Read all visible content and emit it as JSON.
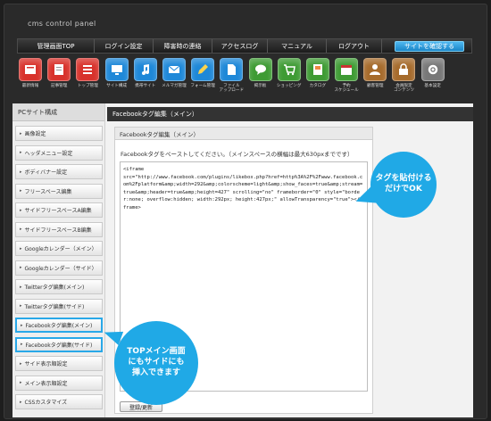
{
  "brand": "cms control panel",
  "nav": {
    "items": [
      "管理画面TOP",
      "ログイン設定",
      "障害時の連絡",
      "アクセスログ",
      "マニュアル",
      "ログアウト"
    ],
    "cta": "サイトを確認する"
  },
  "toolbar": {
    "tools": [
      {
        "label": "最新情報",
        "icon": "news-icon",
        "color": "#d8322b"
      },
      {
        "label": "記事管理",
        "icon": "article-icon",
        "color": "#d8322b"
      },
      {
        "label": "トップ管理",
        "icon": "list-icon",
        "color": "#d8322b"
      },
      {
        "label": "サイト構成",
        "icon": "monitor-icon",
        "color": "#1e88d8"
      },
      {
        "label": "携帯サイト",
        "icon": "note-icon",
        "color": "#1e88d8"
      },
      {
        "label": "メルマガ管理",
        "icon": "mail-icon",
        "color": "#1e88d8"
      },
      {
        "label": "フォーム管理",
        "icon": "pencil-icon",
        "color": "#1e88d8"
      },
      {
        "label": "ファイル\nアップロード",
        "icon": "file-icon",
        "color": "#1e88d8"
      },
      {
        "label": "掲示板",
        "icon": "chat-icon",
        "color": "#3e9b34"
      },
      {
        "label": "ショッピング",
        "icon": "cart-icon",
        "color": "#3e9b34"
      },
      {
        "label": "カタログ",
        "icon": "catalog-icon",
        "color": "#3e9b34"
      },
      {
        "label": "予約\nスケジュール",
        "icon": "calendar-icon",
        "color": "#3e9b34"
      },
      {
        "label": "顧客管理",
        "icon": "customer-icon",
        "color": "#a66b2c"
      },
      {
        "label": "会員限定\nコンテンツ",
        "icon": "member-icon",
        "color": "#a66b2c"
      },
      {
        "label": "基本設定",
        "icon": "settings-icon",
        "color": "#777777"
      }
    ]
  },
  "sidebar": {
    "title": "PCサイト構成",
    "items": [
      "画像設定",
      "ヘッダメニュー設定",
      "ボディバナー設定",
      "フリースペース編集",
      "サイドフリースペースA編集",
      "サイドフリースペースB編集",
      "Googleカレンダー（メイン）",
      "Googleカレンダー（サイド）",
      "Twitterタグ編集(メイン)",
      "Twitterタグ編集(サイド)",
      "Facebookタグ編集(メイン)",
      "Facebookタグ編集(サイド)",
      "サイド表示順設定",
      "メイン表示順設定",
      "CSSカスタマイズ"
    ],
    "highlighted": [
      10,
      11
    ]
  },
  "main": {
    "title": "Facebookタグ編集（メイン）",
    "panel_title": "Facebookタグ編集（メイン）",
    "instruction": "Facebookタグをペーストしてください。（メインスペースの横幅は最大630pxまでです）",
    "code": "<iframe\nsrc=\"http://www.facebook.com/plugins/likebox.php?href=http%3A%2F%2Fwww.facebook.com%2Fplatform&amp;width=292&amp;colorscheme=light&amp;show_faces=true&amp;stream=true&amp;header=true&amp;height=427\" scrolling=\"no\" frameborder=\"0\" style=\"border:none; overflow:hidden; width:292px; height:427px;\" allowTransparency=\"true\"></iframe>",
    "submit": "登録/更新"
  },
  "callouts": {
    "right": "タグを貼付ける\nだけでOK",
    "left": "TOPメイン画面\nにもサイドにも\n挿入できます"
  },
  "colors": {
    "accent": "#20a9e6",
    "nav_bg": "#262626",
    "content_bg": "#f2f2f2"
  }
}
